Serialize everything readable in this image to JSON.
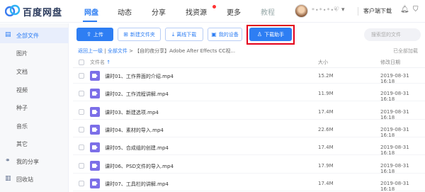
{
  "brand": {
    "name": "百度网盘"
  },
  "nav": {
    "tabs": [
      "网盘",
      "动态",
      "分享",
      "找资源",
      "更多",
      "教程"
    ],
    "vip_badge": "VIP",
    "username": "*•*•*•*",
    "client_download": "客户端下载"
  },
  "sidebar": {
    "items": [
      {
        "label": "全部文件",
        "icon": "folder-icon"
      },
      {
        "label": "图片"
      },
      {
        "label": "文档"
      },
      {
        "label": "视频"
      },
      {
        "label": "种子"
      },
      {
        "label": "音乐"
      },
      {
        "label": "其它"
      },
      {
        "label": "我的分享",
        "icon": "share-icon"
      },
      {
        "label": "回收站",
        "icon": "trash-icon"
      }
    ]
  },
  "toolbar": {
    "upload": "上传",
    "new_folder": "新建文件夹",
    "offline_download": "离线下载",
    "my_devices": "我的设备",
    "download_helper": "下载助手",
    "search_placeholder": "搜索您的文件"
  },
  "breadcrumb": {
    "back": "返回上一级",
    "sep": "|",
    "all_files": "全部文件",
    "current": "【自的夜分享】Adobe After Effects CC视...",
    "count": "已全部加载"
  },
  "table": {
    "headers": {
      "name": "文件名",
      "size": "大小",
      "modified": "修改日期"
    },
    "rows": [
      {
        "name": "课时01、工作界面的介绍.mp4",
        "size": "15.2M",
        "date": "2019-08-31 16:18"
      },
      {
        "name": "课时02、工作流程讲解.mp4",
        "size": "11.9M",
        "date": "2019-08-31 16:18"
      },
      {
        "name": "课时03、新建选项.mp4",
        "size": "17.4M",
        "date": "2019-08-31 16:18"
      },
      {
        "name": "课时04、素材的导入.mp4",
        "size": "22.6M",
        "date": "2019-08-31 16:18"
      },
      {
        "name": "课时05、合成组的创建.mp4",
        "size": "17.4M",
        "date": "2019-08-31 16:18"
      },
      {
        "name": "课时06、PSD文件的导入.mp4",
        "size": "17.9M",
        "date": "2019-08-31 16:18"
      },
      {
        "name": "课时07、工具栏的讲解.mp4",
        "size": "17.4M",
        "date": "2019-08-31 16:18"
      }
    ]
  },
  "colors": {
    "accent": "#2e7ef3",
    "highlight": "#e4001a",
    "video_icon": "#7c6fe8"
  }
}
